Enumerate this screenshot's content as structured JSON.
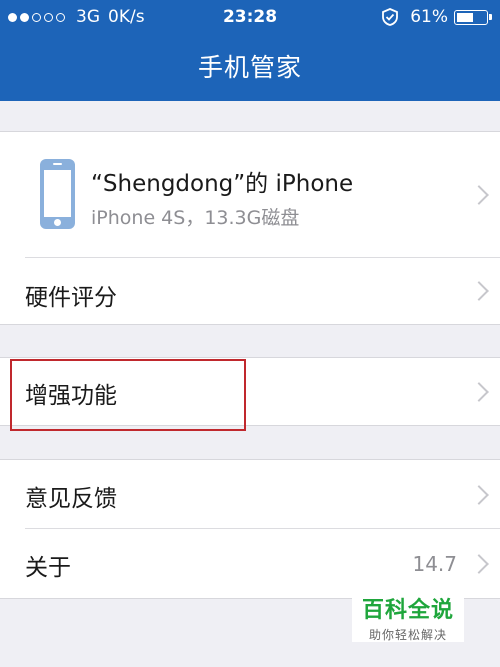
{
  "status_bar": {
    "carrier": "3G",
    "speed": "0K/s",
    "time": "23:28",
    "battery_text": "61%",
    "battery_level": 0.61,
    "signal_bars_full": 2,
    "signal_bars_total": 5
  },
  "header": {
    "title": "手机管家"
  },
  "device": {
    "name": "“Shengdong”的 iPhone",
    "details": "iPhone 4S，13.3G磁盘"
  },
  "menu": {
    "hardware_score": "硬件评分",
    "enhance": "增强功能",
    "feedback": "意见反馈",
    "about": "关于",
    "about_version": "14.7"
  },
  "watermark": {
    "main": "百科全说",
    "sub": "助你轻松解决"
  },
  "colors": {
    "header_bg": "#1d64b8",
    "highlight_border": "#c0282d",
    "watermark_green": "#1fa63c"
  }
}
